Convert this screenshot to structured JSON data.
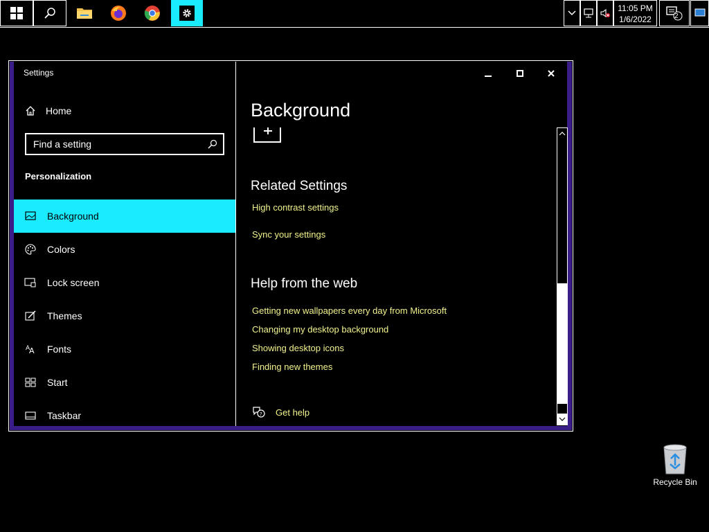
{
  "taskbar": {
    "clock_time": "11:05 PM",
    "clock_date": "1/6/2022",
    "notification_count": "2"
  },
  "window": {
    "title": "Settings"
  },
  "sidebar": {
    "home_label": "Home",
    "search_placeholder": "Find a setting",
    "section_title": "Personalization",
    "items": [
      {
        "label": "Background",
        "icon": "picture-icon"
      },
      {
        "label": "Colors",
        "icon": "palette-icon"
      },
      {
        "label": "Lock screen",
        "icon": "lock-screen-icon"
      },
      {
        "label": "Themes",
        "icon": "themes-icon"
      },
      {
        "label": "Fonts",
        "icon": "fonts-icon"
      },
      {
        "label": "Start",
        "icon": "start-icon"
      },
      {
        "label": "Taskbar",
        "icon": "taskbar-icon"
      }
    ]
  },
  "content": {
    "page_title": "Background",
    "related_title": "Related Settings",
    "related_links": [
      "High contrast settings",
      "Sync your settings"
    ],
    "help_title": "Help from the web",
    "help_links": [
      "Getting new wallpapers every day from Microsoft",
      "Changing my desktop background",
      "Showing desktop icons",
      "Finding new themes"
    ],
    "get_help": "Get help"
  },
  "desktop": {
    "recycle_bin": "Recycle Bin"
  },
  "colors": {
    "accent": "#1aebff",
    "link": "#f2f28c",
    "frame": "#3b1d8a"
  }
}
